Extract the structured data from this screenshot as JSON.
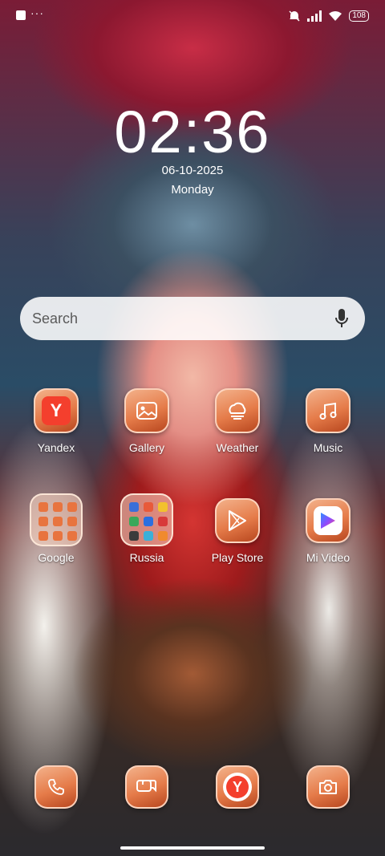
{
  "status_bar": {
    "notification_dots": "···",
    "battery": "108"
  },
  "lockscreen": {
    "time": "02:36",
    "date": "06-10-2025",
    "day": "Monday"
  },
  "search": {
    "placeholder": "Search"
  },
  "apps_row1": [
    {
      "label": "Yandex",
      "icon": "yandex-icon"
    },
    {
      "label": "Gallery",
      "icon": "gallery-icon"
    },
    {
      "label": "Weather",
      "icon": "weather-icon"
    },
    {
      "label": "Music",
      "icon": "music-icon"
    }
  ],
  "apps_row2": [
    {
      "label": "Google",
      "icon": "folder-icon"
    },
    {
      "label": "Russia",
      "icon": "folder-icon"
    },
    {
      "label": "Play Store",
      "icon": "play-store-icon"
    },
    {
      "label": "Mi Video",
      "icon": "mi-video-icon"
    }
  ],
  "dock": [
    {
      "name": "phone",
      "icon": "phone-icon"
    },
    {
      "name": "messages",
      "icon": "messages-icon"
    },
    {
      "name": "yandex-browser",
      "icon": "yandex-browser-icon"
    },
    {
      "name": "camera",
      "icon": "camera-icon"
    }
  ],
  "colors": {
    "icon_orange": "#e57b49",
    "yandex_red": "#f43f2d"
  }
}
